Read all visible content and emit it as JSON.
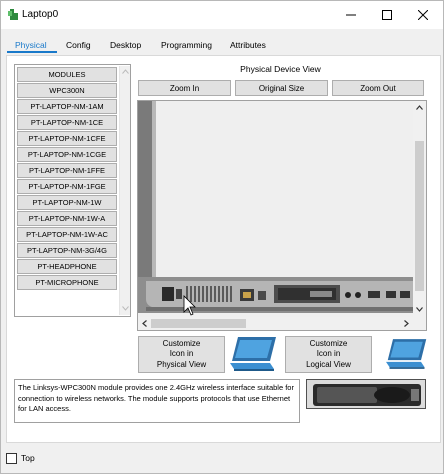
{
  "window": {
    "title": "Laptop0",
    "controls": {
      "minimize": "minimize-icon",
      "maximize": "maximize-icon",
      "close": "close-icon"
    }
  },
  "tabs": [
    {
      "label": "Physical",
      "active": true
    },
    {
      "label": "Config",
      "active": false
    },
    {
      "label": "Desktop",
      "active": false
    },
    {
      "label": "Programming",
      "active": false
    },
    {
      "label": "Attributes",
      "active": false
    }
  ],
  "modules": {
    "header": "MODULES",
    "items": [
      "WPC300N",
      "PT-LAPTOP-NM-1AM",
      "PT-LAPTOP-NM-1CE",
      "PT-LAPTOP-NM-1CFE",
      "PT-LAPTOP-NM-1CGE",
      "PT-LAPTOP-NM-1FFE",
      "PT-LAPTOP-NM-1FGE",
      "PT-LAPTOP-NM-1W",
      "PT-LAPTOP-NM-1W-A",
      "PT-LAPTOP-NM-1W-AC",
      "PT-LAPTOP-NM-3G/4G",
      "PT-HEADPHONE",
      "PT-MICROPHONE"
    ]
  },
  "physical_view": {
    "title": "Physical Device View",
    "zoom_in": "Zoom In",
    "original_size": "Original Size",
    "zoom_out": "Zoom Out"
  },
  "customize": {
    "physical": "Customize\nIcon in\nPhysical View",
    "logical": "Customize\nIcon in\nLogical View"
  },
  "description": "The Linksys-WPC300N module provides one 2.4GHz wireless interface suitable for connection to wireless networks. The module supports protocols that use Ethernet for LAN access.",
  "footer": {
    "top_label": "Top",
    "top_checked": false
  },
  "colors": {
    "accent": "#1979ca",
    "button_bg": "#e1e1e1",
    "laptop_screen": "#3b8fd1"
  }
}
